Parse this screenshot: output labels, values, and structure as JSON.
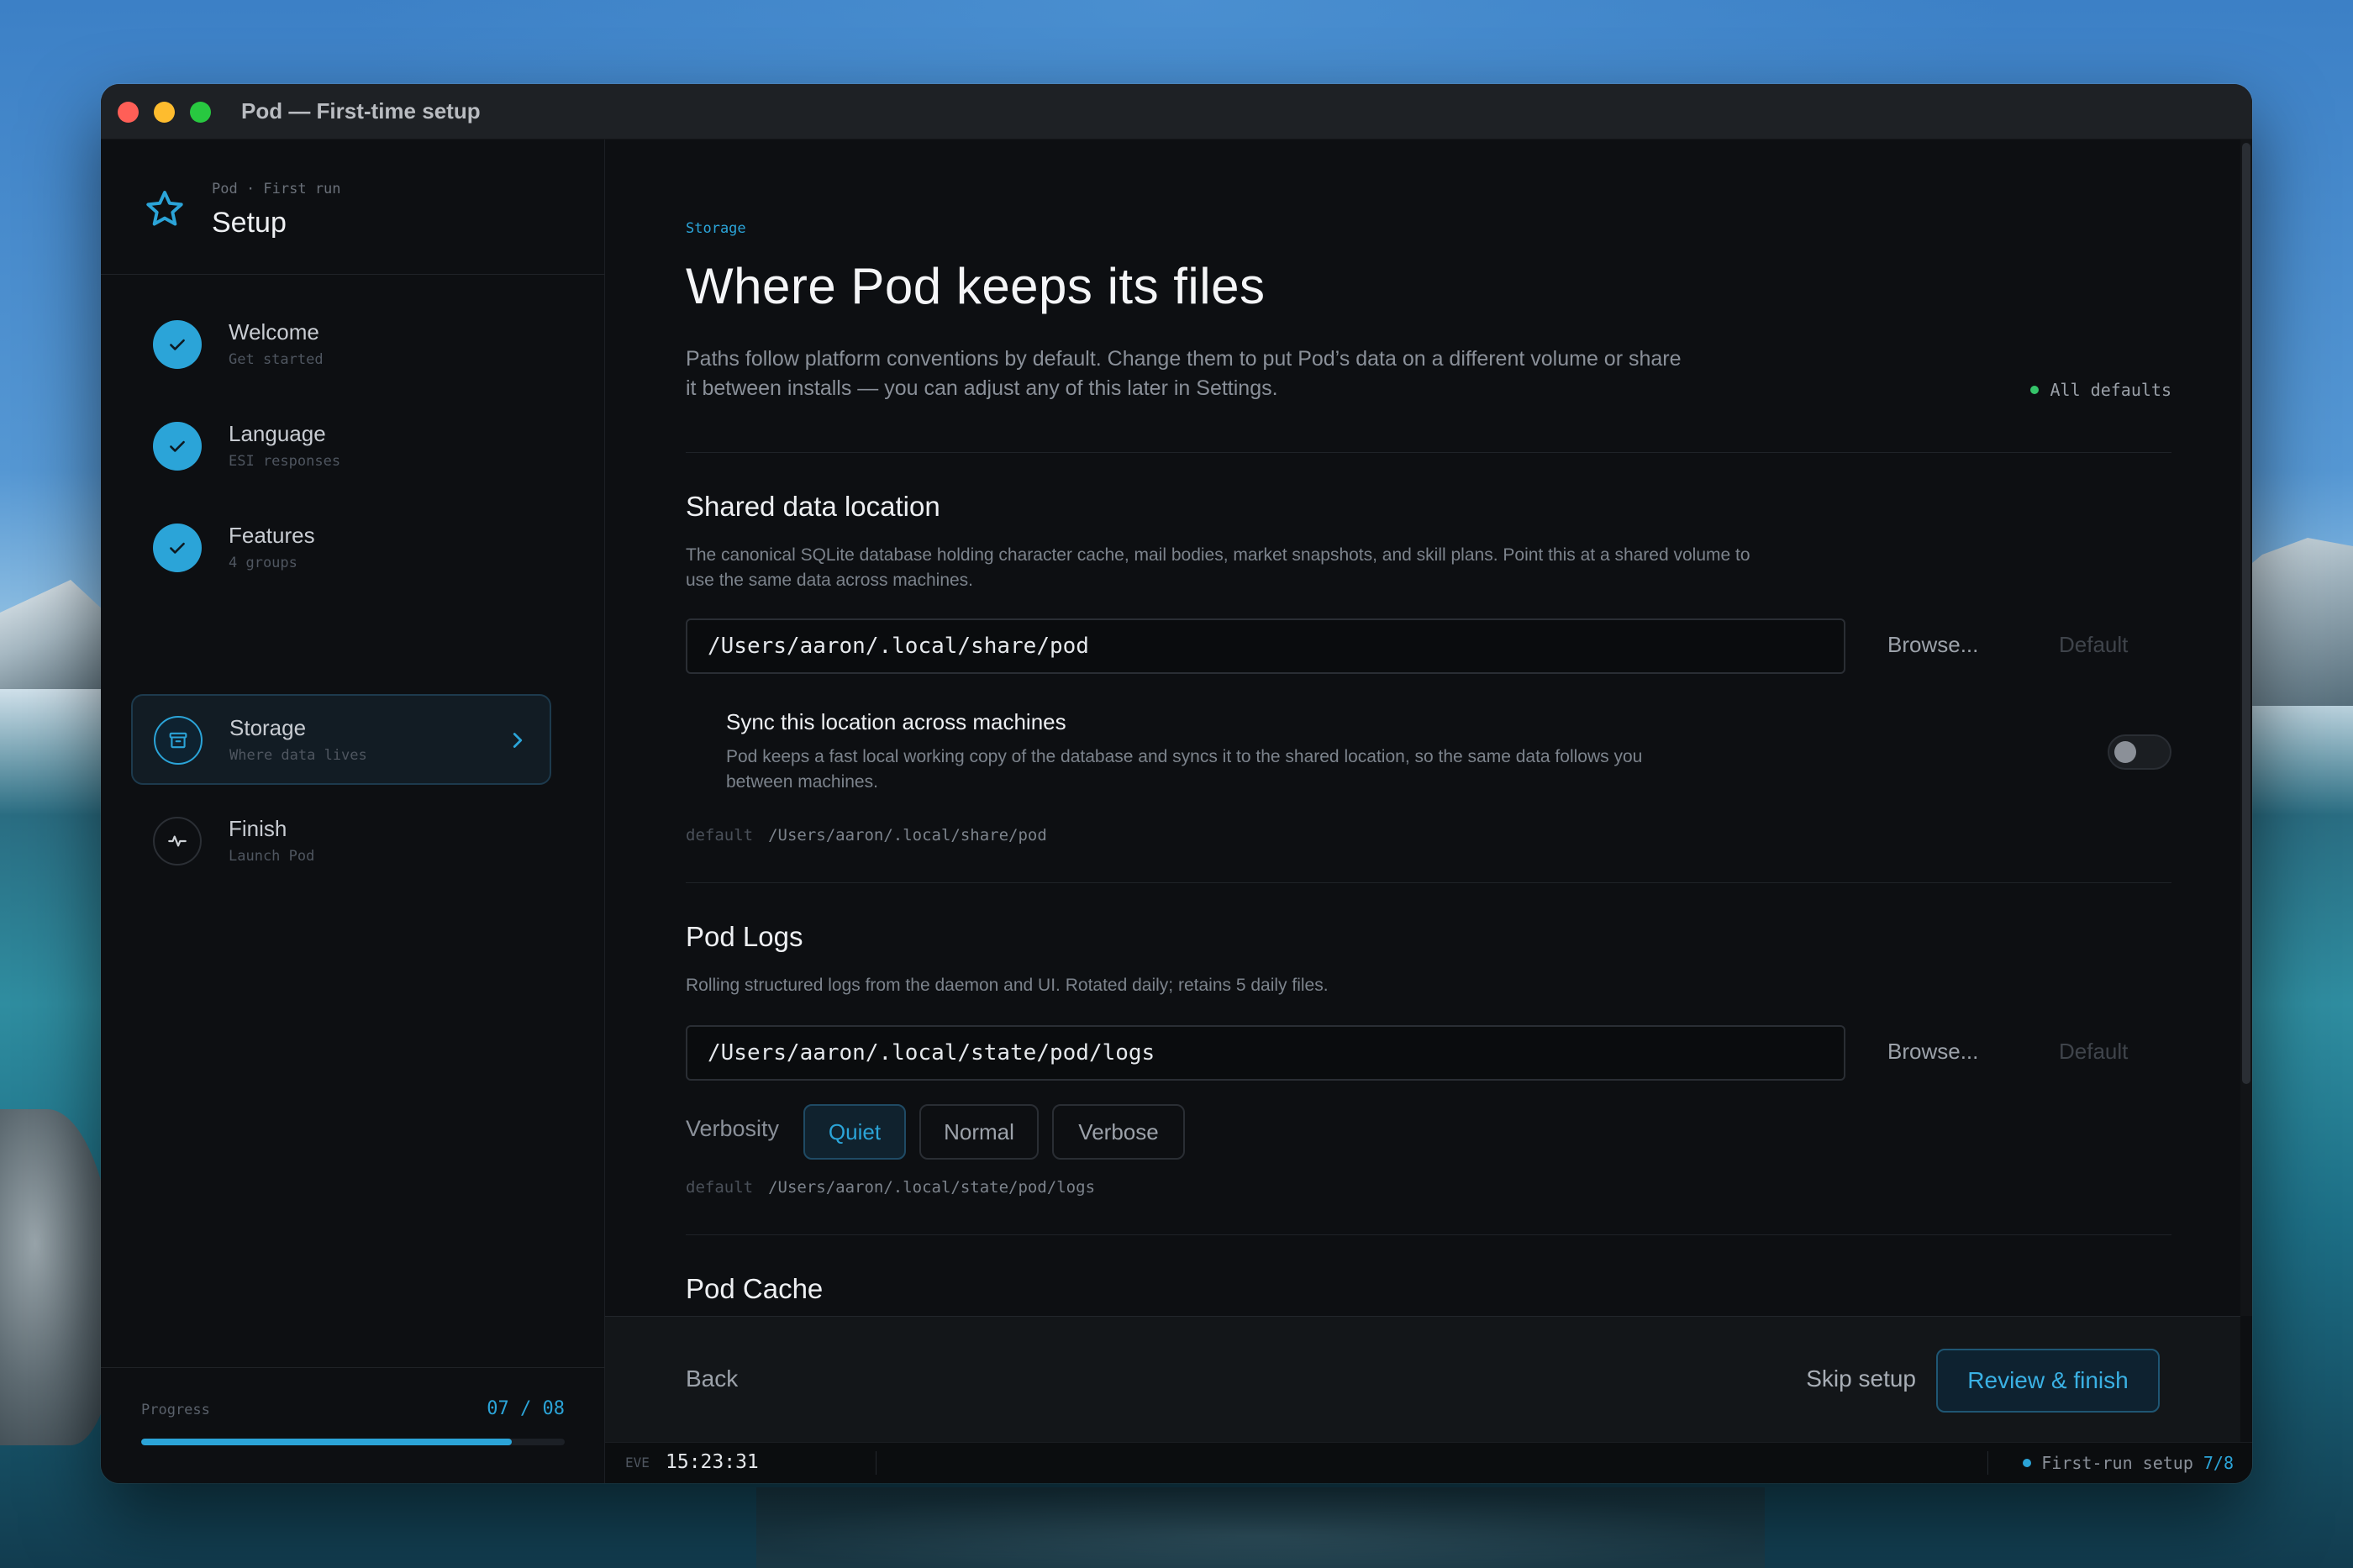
{
  "window": {
    "title": "Pod — First-time setup"
  },
  "sidebar": {
    "kicker": "Pod · First run",
    "title": "Setup",
    "steps": [
      {
        "label": "Welcome",
        "sub": "Get started",
        "state": "done",
        "icon": "check-icon"
      },
      {
        "label": "Language",
        "sub": "ESI responses",
        "state": "done",
        "icon": "check-icon"
      },
      {
        "label": "Features",
        "sub": "4 groups",
        "state": "done",
        "icon": "check-icon"
      },
      {
        "label": "Storage",
        "sub": "Where data lives",
        "state": "current",
        "icon": "archive-icon"
      },
      {
        "label": "Finish",
        "sub": "Launch Pod",
        "state": "pending",
        "icon": "pulse-icon"
      }
    ],
    "progress": {
      "label": "Progress",
      "count": "07 / 08",
      "fraction": 0.875
    }
  },
  "page": {
    "kicker": "Storage",
    "title": "Where Pod keeps its files",
    "description": "Paths follow platform conventions by default. Change them to put Pod’s data on a different volume or share it between installs — you can adjust any of this later in Settings.",
    "badge": "All defaults"
  },
  "shared": {
    "title": "Shared data location",
    "description": "The canonical SQLite database holding character cache, mail bodies, market snapshots, and skill plans. Point this at a shared volume to use the same data across machines.",
    "path": "/Users/aaron/.local/share/pod",
    "browse": "Browse...",
    "default_btn": "Default",
    "sync_title": "Sync this location across machines",
    "sync_desc": "Pod keeps a fast local working copy of the database and syncs it to the shared location, so the same data follows you between machines.",
    "sync_enabled": false,
    "default_key": "default",
    "default_value": "/Users/aaron/.local/share/pod"
  },
  "logs": {
    "title": "Pod Logs",
    "description": "Rolling structured logs from the daemon and UI. Rotated daily; retains 5 daily files.",
    "path": "/Users/aaron/.local/state/pod/logs",
    "browse": "Browse...",
    "default_btn": "Default",
    "verbosity_label": "Verbosity",
    "verbosity_options": [
      "Quiet",
      "Normal",
      "Verbose"
    ],
    "verbosity_selected": "Quiet",
    "default_key": "default",
    "default_value": "/Users/aaron/.local/state/pod/logs"
  },
  "cache": {
    "title": "Pod Cache"
  },
  "actions": {
    "back": "Back",
    "skip": "Skip setup",
    "finish": "Review & finish"
  },
  "status": {
    "eve_label": "EVE",
    "eve_time": "15:23:31",
    "mode": "First-run setup",
    "step": "7/8"
  },
  "colors": {
    "accent": "#2ba4d8",
    "ok": "#35c46a"
  }
}
